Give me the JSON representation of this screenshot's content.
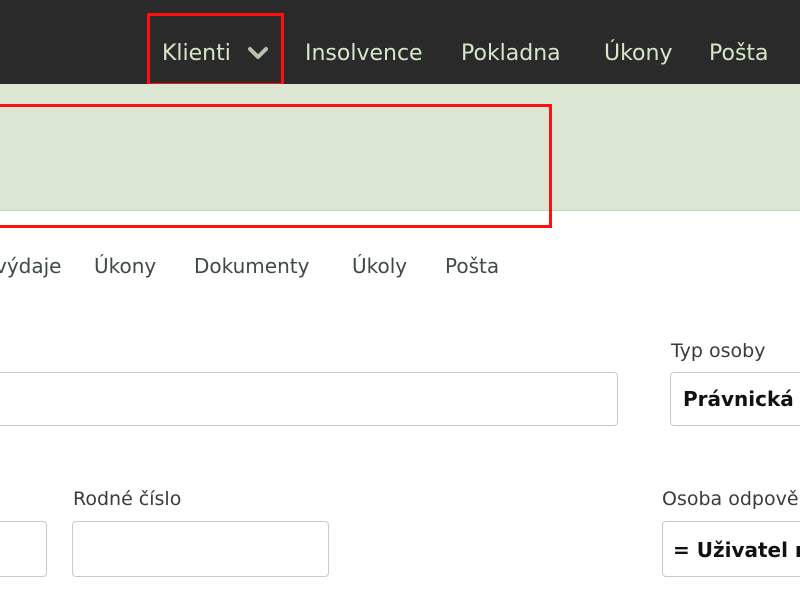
{
  "topnav": {
    "items": [
      {
        "label": "Klienti",
        "has_dropdown": true,
        "highlighted": true
      },
      {
        "label": "Insolvence"
      },
      {
        "label": "Pokladna"
      },
      {
        "label": "Úkony"
      },
      {
        "label": "Pošta"
      }
    ]
  },
  "subnav": {
    "items": [
      {
        "label": "výdaje"
      },
      {
        "label": "Úkony"
      },
      {
        "label": "Dokumenty"
      },
      {
        "label": "Úkoly"
      },
      {
        "label": "Pošta"
      }
    ]
  },
  "form": {
    "typ_osoby": {
      "label": "Typ osoby",
      "value": "Právnická"
    },
    "rodne_cislo": {
      "label": "Rodné číslo",
      "value": ""
    },
    "osoba_odpovedna": {
      "label": "Osoba odpově",
      "value": "= Uživatel n"
    }
  },
  "colors": {
    "topnav_bg": "#2a2a2a",
    "topnav_text": "#d4e7c8",
    "subnav_bg": "#dbe6d3",
    "highlight": "#ff1010"
  }
}
